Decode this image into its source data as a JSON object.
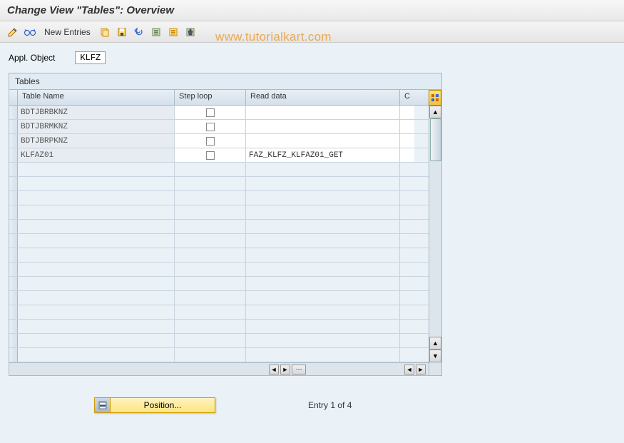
{
  "title": "Change View \"Tables\": Overview",
  "toolbar": {
    "new_entries": "New Entries"
  },
  "appl_object": {
    "label": "Appl. Object",
    "value": "KLFZ"
  },
  "tables": {
    "panel_title": "Tables",
    "columns": {
      "name": "Table Name",
      "step": "Step loop",
      "read": "Read data",
      "c": "C"
    },
    "rows": [
      {
        "name": "BDTJBRBKNZ",
        "step": false,
        "read": ""
      },
      {
        "name": "BDTJBRMKNZ",
        "step": false,
        "read": ""
      },
      {
        "name": "BDTJBRPKNZ",
        "step": false,
        "read": ""
      },
      {
        "name": "KLFAZ01",
        "step": false,
        "read": "FAZ_KLFZ_KLFAZ01_GET"
      }
    ],
    "empty_rows": 14
  },
  "footer": {
    "position_label": "Position...",
    "entry_text": "Entry 1 of 4"
  },
  "watermark": "www.tutorialkart.com"
}
